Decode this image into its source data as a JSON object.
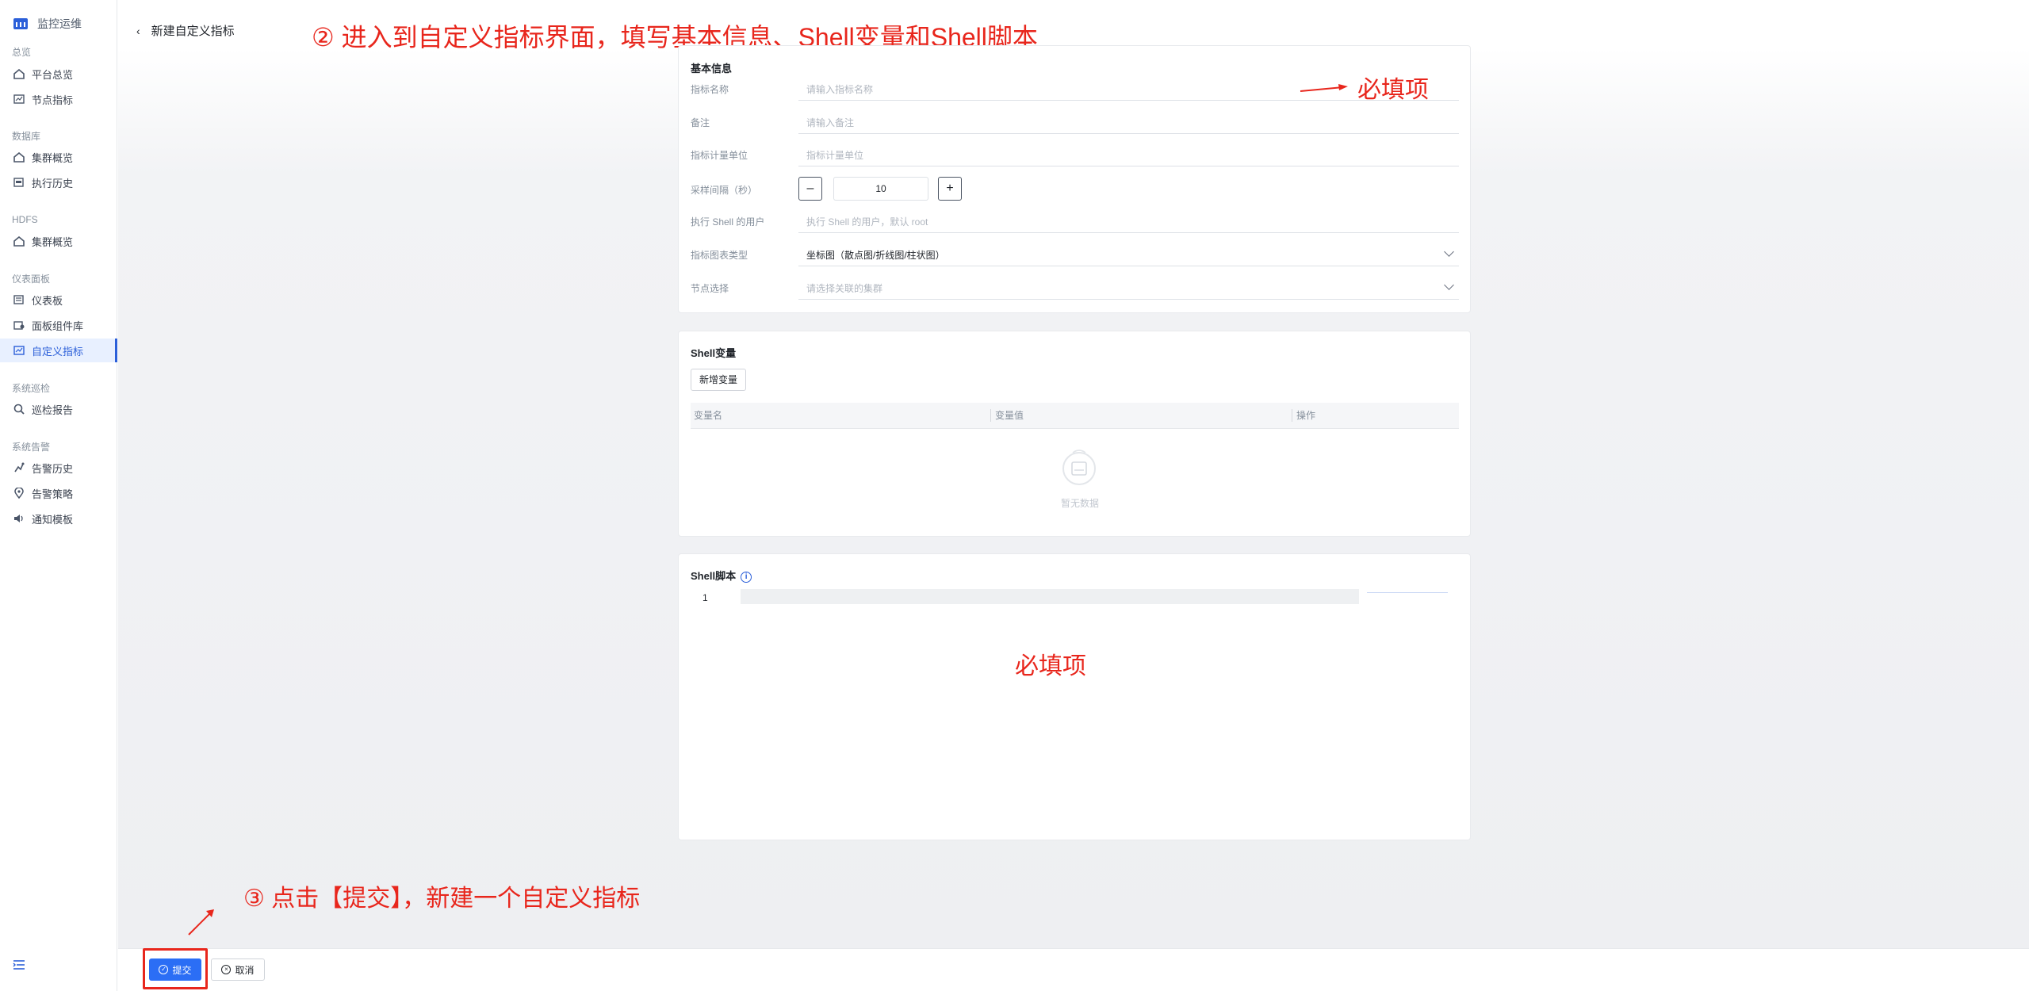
{
  "sidebar": {
    "brand": "监控运维",
    "groups": [
      {
        "title": "总览",
        "items": [
          {
            "label": "平台总览",
            "icon": "home-icon"
          },
          {
            "label": "节点指标",
            "icon": "chart-icon"
          }
        ]
      },
      {
        "title": "数据库",
        "items": [
          {
            "label": "集群概览",
            "icon": "home-icon"
          },
          {
            "label": "执行历史",
            "icon": "history-icon"
          }
        ]
      },
      {
        "title": "HDFS",
        "items": [
          {
            "label": "集群概览",
            "icon": "home-icon"
          }
        ]
      },
      {
        "title": "仪表面板",
        "items": [
          {
            "label": "仪表板",
            "icon": "dashboard-icon"
          },
          {
            "label": "面板组件库",
            "icon": "library-icon"
          },
          {
            "label": "自定义指标",
            "icon": "custom-metric-icon",
            "active": true
          }
        ]
      },
      {
        "title": "系统巡检",
        "items": [
          {
            "label": "巡检报告",
            "icon": "search-report-icon"
          }
        ]
      },
      {
        "title": "系统告警",
        "items": [
          {
            "label": "告警历史",
            "icon": "alarm-history-icon"
          },
          {
            "label": "告警策略",
            "icon": "location-icon"
          },
          {
            "label": "通知模板",
            "icon": "speaker-icon"
          }
        ]
      }
    ]
  },
  "header": {
    "back_title": "新建自定义指标"
  },
  "basic_info": {
    "title": "基本信息",
    "fields": {
      "name": {
        "label": "指标名称",
        "placeholder": "请输入指标名称"
      },
      "remark": {
        "label": "备注",
        "placeholder": "请输入备注"
      },
      "unit": {
        "label": "指标计量单位",
        "placeholder": "指标计量单位"
      },
      "interval": {
        "label": "采样间隔（秒）",
        "value": "10",
        "minus": "–",
        "plus": "+"
      },
      "shell_user": {
        "label": "执行 Shell 的用户",
        "placeholder": "执行 Shell 的用户，默认 root"
      },
      "chart_type": {
        "label": "指标图表类型",
        "value": "坐标图（散点图/折线图/柱状图）"
      },
      "node_select": {
        "label": "节点选择",
        "placeholder": "请选择关联的集群"
      }
    }
  },
  "shell_vars": {
    "title": "Shell变量",
    "add_button": "新增变量",
    "columns": [
      "变量名",
      "变量值",
      "操作"
    ],
    "empty_text": "暂无数据"
  },
  "shell_script": {
    "title": "Shell脚本",
    "line_number": "1"
  },
  "annotations": {
    "step2": "② 进入到自定义指标界面，填写基本信息、Shell变量和Shell脚本",
    "required1": "必填项",
    "required2": "必填项",
    "step3": "③ 点击【提交】，新建一个自定义指标"
  },
  "footer": {
    "submit": "提交",
    "cancel": "取消"
  },
  "colors": {
    "accent": "#2b6ef5",
    "annotation": "#e8261c",
    "active_bg": "#e8f0ff"
  }
}
